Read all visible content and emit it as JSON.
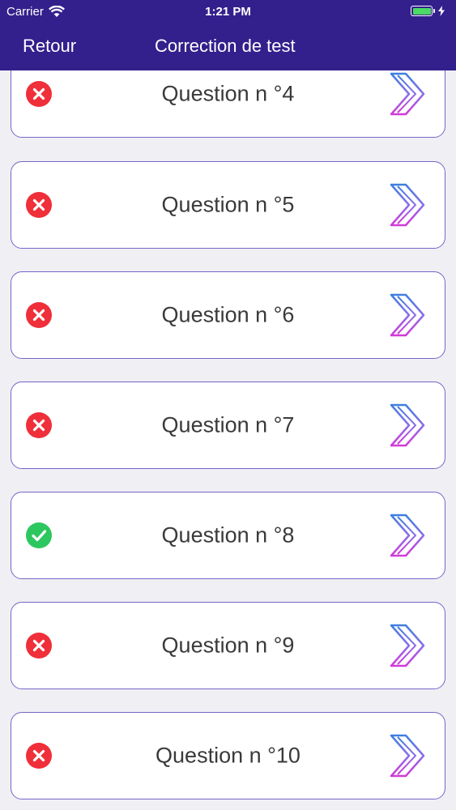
{
  "status_bar": {
    "carrier": "Carrier",
    "time": "1:21 PM"
  },
  "nav": {
    "back_label": "Retour",
    "title": "Correction de test"
  },
  "colors": {
    "header": "#33208c",
    "wrong": "#ef2f3a",
    "correct": "#2dc75f",
    "card_border": "#7467c8"
  },
  "questions": [
    {
      "label": "Question n °4",
      "status": "wrong"
    },
    {
      "label": "Question n °5",
      "status": "wrong"
    },
    {
      "label": "Question n °6",
      "status": "wrong"
    },
    {
      "label": "Question n °7",
      "status": "wrong"
    },
    {
      "label": "Question n °8",
      "status": "correct"
    },
    {
      "label": "Question n °9",
      "status": "wrong"
    },
    {
      "label": "Question n °10",
      "status": "wrong"
    }
  ]
}
